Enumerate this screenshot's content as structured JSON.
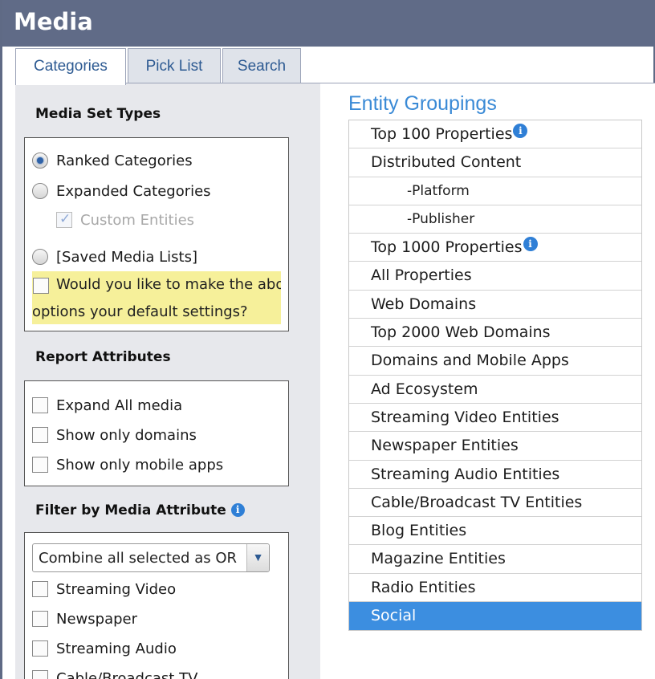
{
  "window": {
    "title": "Media"
  },
  "tabs": [
    {
      "label": "Categories",
      "active": true
    },
    {
      "label": "Pick List",
      "active": false
    },
    {
      "label": "Search",
      "active": false
    }
  ],
  "left": {
    "media_set_types": {
      "heading": "Media Set Types",
      "ranked": "Ranked Categories",
      "expanded": "Expanded Categories",
      "custom_entities": "Custom Entities",
      "saved_lists": "[Saved Media Lists]",
      "default_line1": "Would you like to make the abov",
      "default_line2": "options your default settings?"
    },
    "report_attributes": {
      "heading": "Report Attributes",
      "items": [
        "Expand All media",
        "Show only domains",
        "Show only mobile apps"
      ]
    },
    "filter": {
      "heading": "Filter by Media Attribute",
      "select_value": "Combine all selected as OR",
      "items": [
        "Streaming Video",
        "Newspaper",
        "Streaming Audio",
        "Cable/Broadcast TV"
      ]
    }
  },
  "right": {
    "title": "Entity Groupings",
    "items": [
      "Top 100 Properties",
      "Distributed Content",
      "-Platform",
      "-Publisher",
      "Top 1000 Properties",
      "All Properties",
      "Web Domains",
      "Top 2000 Web Domains",
      "Domains and Mobile Apps",
      "Ad Ecosystem",
      "Streaming Video Entities",
      "Newspaper Entities",
      "Streaming Audio Entities",
      "Cable/Broadcast TV Entities",
      "Blog Entities",
      "Magazine Entities",
      "Radio Entities",
      "Social"
    ],
    "selected": "Social"
  },
  "colors": {
    "titlebar": "#606b87",
    "accent": "#3c8ee0",
    "highlight": "#f6f09a",
    "tab_text": "#2d5a92"
  }
}
